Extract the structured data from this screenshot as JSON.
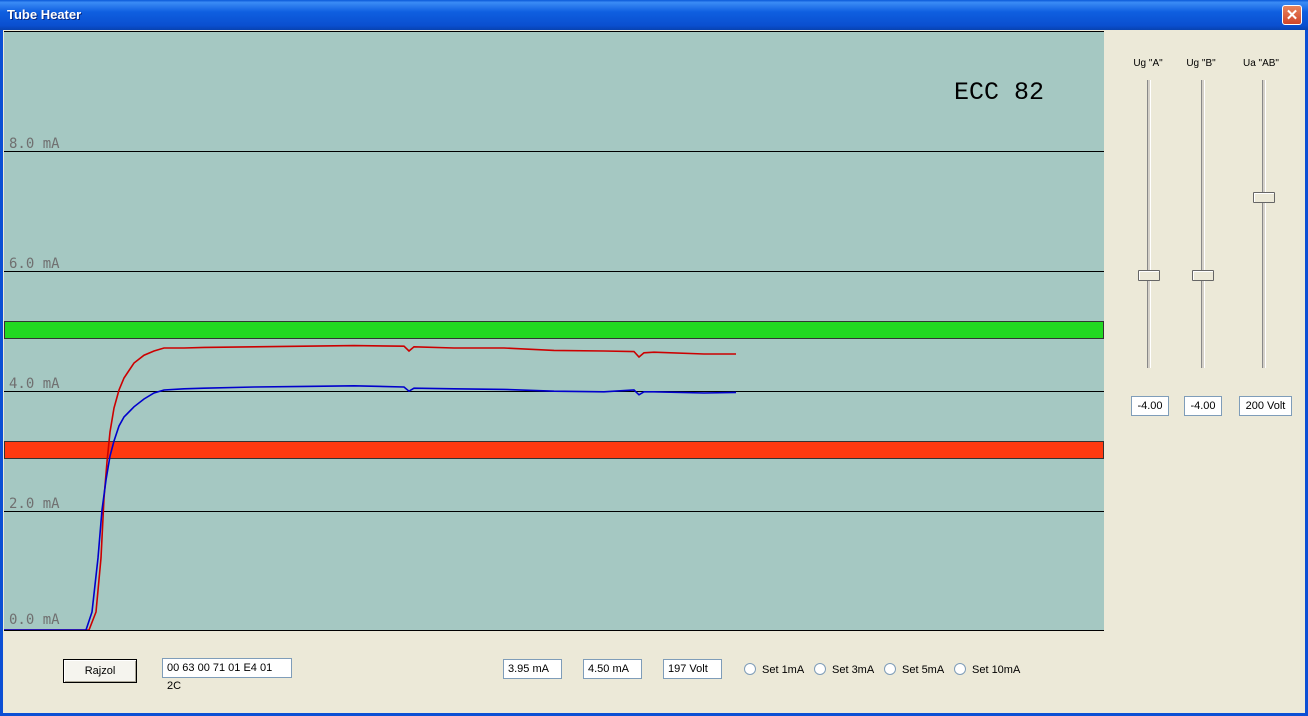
{
  "window": {
    "title": "Tube Heater"
  },
  "plot": {
    "tube_name": "ECC 82",
    "y_labels": [
      "8.0 mA",
      "6.0 mA",
      "4.0 mA",
      "2.0 mA",
      "0.0 mA"
    ],
    "colors": {
      "background": "#a5c8c2",
      "upper_band": "#22d822",
      "lower_band": "#ff3a10",
      "series_a": "#cc0000",
      "series_b": "#0000cc"
    }
  },
  "chart_data": {
    "type": "line",
    "ylim": [
      0,
      10
    ],
    "xlim": [
      0,
      1100
    ],
    "y_ticks": [
      0,
      2,
      4,
      6,
      8
    ],
    "grid": true,
    "bands": [
      {
        "y_low": 4.85,
        "y_high": 5.15,
        "color": "#22d822"
      },
      {
        "y_low": 2.85,
        "y_high": 3.15,
        "color": "#ff3a10"
      }
    ],
    "series": [
      {
        "color": "#cc0000",
        "x": [
          0,
          85,
          92,
          97,
          100,
          103,
          106,
          110,
          115,
          120,
          130,
          140,
          150,
          160,
          180,
          200,
          250,
          300,
          350,
          400,
          405,
          410,
          450,
          500,
          550,
          600,
          630,
          635,
          640,
          650,
          700,
          732
        ],
        "y": [
          0,
          0,
          0.3,
          1.2,
          2.2,
          2.8,
          3.3,
          3.7,
          4.0,
          4.2,
          4.45,
          4.58,
          4.65,
          4.7,
          4.7,
          4.71,
          4.72,
          4.73,
          4.74,
          4.73,
          4.65,
          4.72,
          4.7,
          4.7,
          4.66,
          4.65,
          4.64,
          4.55,
          4.62,
          4.63,
          4.6,
          4.6
        ]
      },
      {
        "color": "#0000cc",
        "x": [
          0,
          82,
          88,
          94,
          98,
          102,
          106,
          110,
          115,
          120,
          130,
          140,
          150,
          160,
          180,
          200,
          250,
          300,
          350,
          400,
          405,
          410,
          450,
          500,
          550,
          600,
          630,
          635,
          640,
          650,
          700,
          732
        ],
        "y": [
          0,
          0,
          0.3,
          1.2,
          2.0,
          2.5,
          2.9,
          3.15,
          3.4,
          3.55,
          3.72,
          3.85,
          3.95,
          4.0,
          4.02,
          4.03,
          4.05,
          4.06,
          4.07,
          4.05,
          3.98,
          4.03,
          4.02,
          4.01,
          3.98,
          3.97,
          4.0,
          3.92,
          3.97,
          3.97,
          3.95,
          3.96
        ]
      }
    ]
  },
  "sliders": [
    {
      "label": "Ug \"A\"",
      "value_text": "-4.00",
      "level": 0.32
    },
    {
      "label": "Ug \"B\"",
      "value_text": "-4.00",
      "level": 0.32
    },
    {
      "label": "Ua \"AB\"",
      "value_text": "200 Volt",
      "level": 0.6
    }
  ],
  "bottom": {
    "draw_button": "Rajzol",
    "hex_field": "00 63 00 71 01 E4 01 2C",
    "current_a": "3.95 mA",
    "current_b": "4.50 mA",
    "voltage": "197 Volt",
    "radios": [
      "Set 1mA",
      "Set 3mA",
      "Set 5mA",
      "Set 10mA"
    ]
  }
}
